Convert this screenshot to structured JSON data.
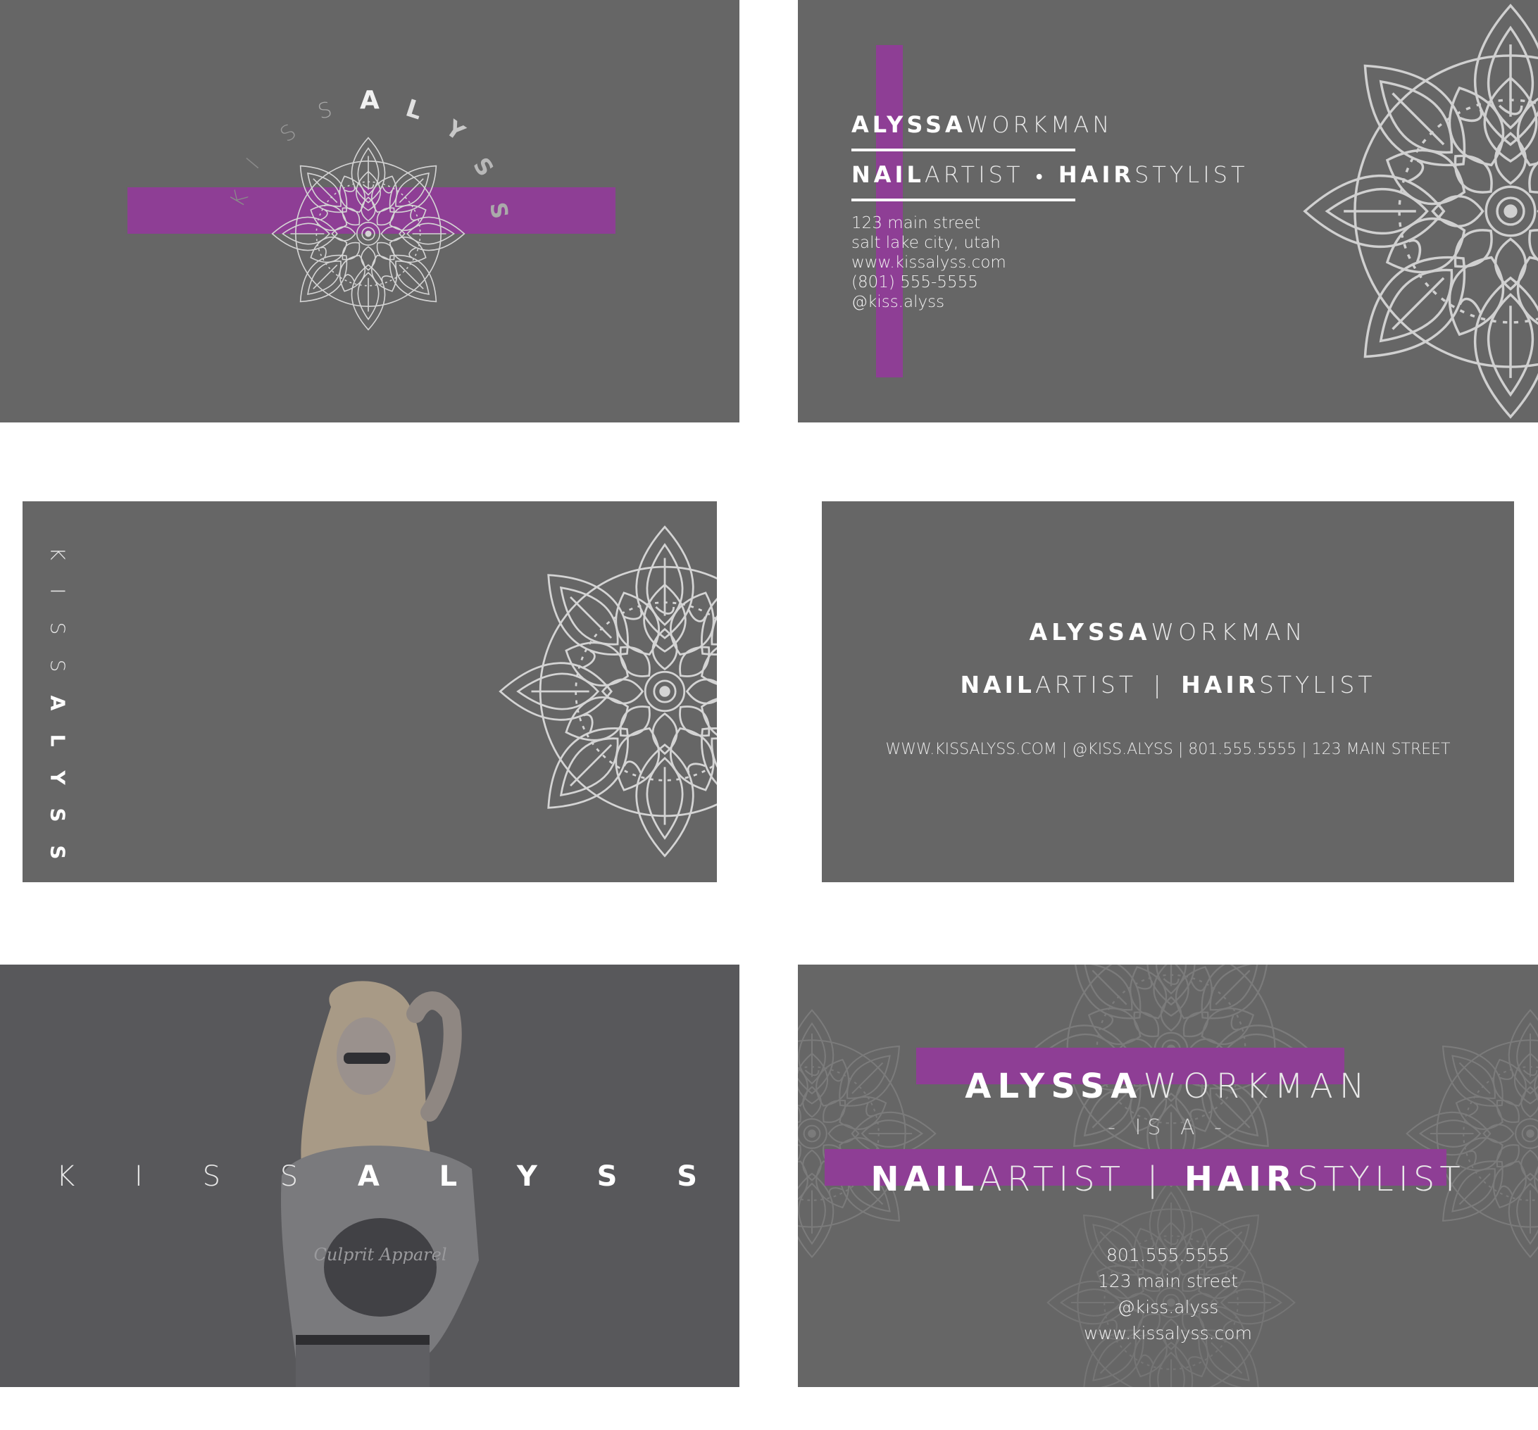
{
  "brand": {
    "first": [
      "K",
      "I",
      "S",
      "S"
    ],
    "second": [
      "A",
      "L",
      "Y",
      "S",
      "S"
    ]
  },
  "name": {
    "first": "ALYSSA",
    "last": "WORKMAN"
  },
  "title": {
    "nail": "NAIL",
    "artist": "ARTIST",
    "hair": "HAIR",
    "stylist": "STYLIST",
    "dot": "•",
    "pipe": "|"
  },
  "card2": {
    "address": "123 main street",
    "city": "salt lake city, utah",
    "website": "www.kissalyss.com",
    "phone": "(801) 555-5555",
    "handle": "@kiss.alyss"
  },
  "card4": {
    "info_line": "WWW.KISSALYSS.COM | @KISS.ALYSS | 801.555.5555 | 123 MAIN STREET"
  },
  "card5": {
    "photo_caption": "Culprit Apparel"
  },
  "card6": {
    "is_a": "- IS A -",
    "phone": "801.555.5555",
    "address": "123 main street",
    "handle": "@kiss.alyss",
    "website": "www.kissalyss.com"
  },
  "colors": {
    "card_bg": "#666666",
    "accent": "#8e3e95",
    "mandala": "#c9c9c9"
  },
  "icons": [
    "mandala-ornament"
  ]
}
